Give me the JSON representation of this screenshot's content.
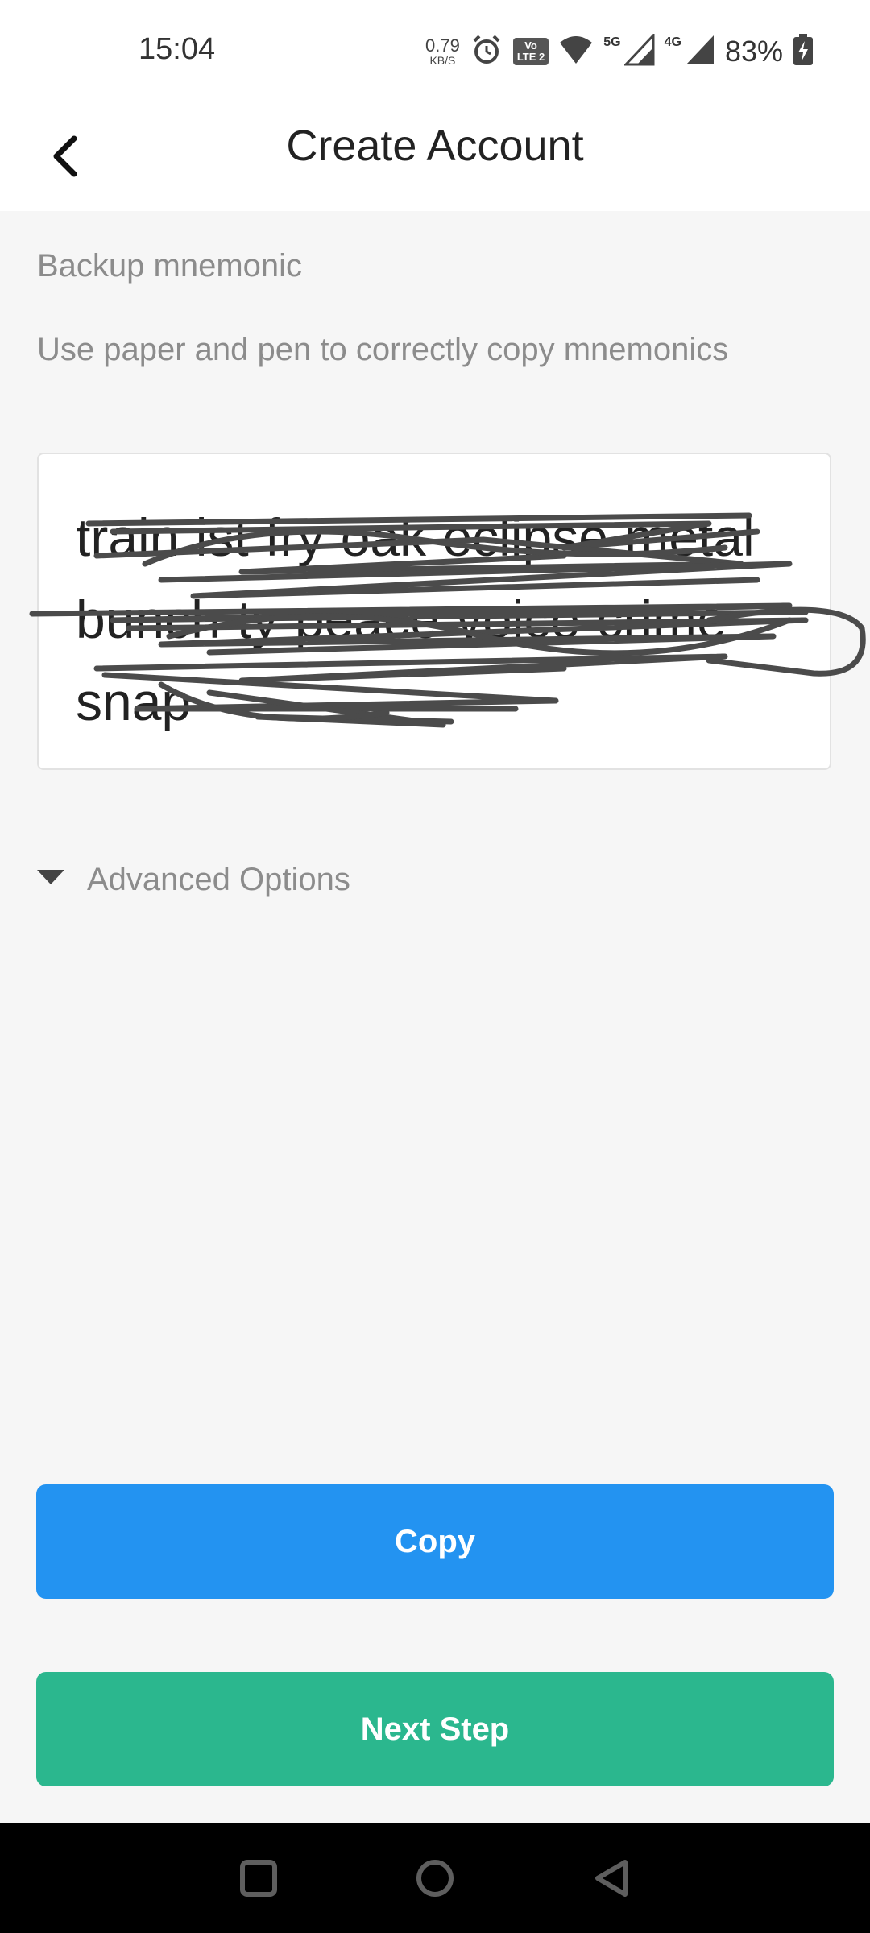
{
  "status_bar": {
    "time": "15:04",
    "net_speed_value": "0.79",
    "net_speed_unit": "KB/S",
    "volte_top": "Vo",
    "volte_bottom": "LTE 2",
    "signal1_label": "5G",
    "signal2_label": "4G",
    "battery_percent": "83%",
    "icons": [
      "alarm-icon",
      "wifi-icon",
      "signal-5g-icon",
      "signal-4g-icon",
      "battery-charging-icon"
    ]
  },
  "header": {
    "title": "Create Account",
    "back_icon": "chevron-left-icon"
  },
  "content": {
    "section_label": "Backup mnemonic",
    "instructions": "Use paper and pen to correctly copy mnemonics",
    "mnemonic_text": "train ist fry oak eclipse metal bunch ty peace voice crime snap",
    "advanced_options_label": "Advanced Options"
  },
  "buttons": {
    "copy_label": "Copy",
    "next_label": "Next Step"
  },
  "colors": {
    "copy_button": "#2393f1",
    "next_button": "#2bb78e",
    "background": "#f6f6f6",
    "secondary_text": "#8c8c8c"
  },
  "nav": {
    "icons": [
      "recent-apps-icon",
      "home-icon",
      "back-icon"
    ]
  }
}
